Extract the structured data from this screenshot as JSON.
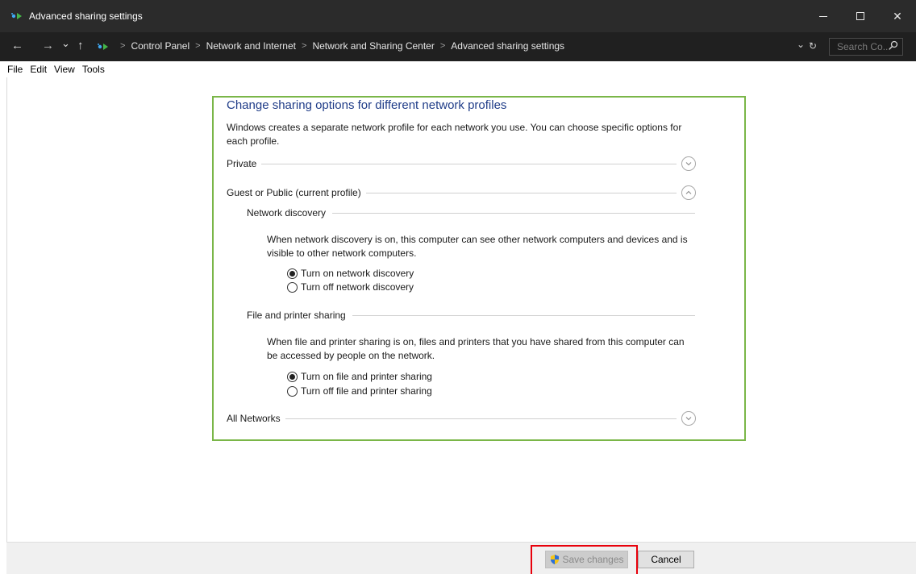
{
  "window": {
    "title": "Advanced sharing settings",
    "controls": {
      "minimize": "—",
      "close": "✕"
    }
  },
  "nav": {
    "back": "←",
    "forward": "→",
    "recent": "⌄",
    "up": "↑"
  },
  "breadcrumbs": [
    "Control Panel",
    "Network and Internet",
    "Network and Sharing Center",
    "Advanced sharing settings"
  ],
  "breadcrumb_separator": ">",
  "address": {
    "dropdown": "⌄",
    "refresh": "↻"
  },
  "search": {
    "placeholder": "Search Co...",
    "icon": "search-icon"
  },
  "menu": [
    "File",
    "Edit",
    "View",
    "Tools"
  ],
  "main": {
    "heading": "Change sharing options for different network profiles",
    "description": "Windows creates a separate network profile for each network you use. You can choose specific options for each profile.",
    "profiles": {
      "private": {
        "label": "Private",
        "expanded": false
      },
      "guest": {
        "label": "Guest or Public (current profile)",
        "expanded": true
      },
      "all": {
        "label": "All Networks",
        "expanded": false
      }
    },
    "network_discovery": {
      "label": "Network discovery",
      "description": "When network discovery is on, this computer can see other network computers and devices and is visible to other network computers.",
      "options": [
        {
          "label": "Turn on network discovery",
          "selected": true
        },
        {
          "label": "Turn off network discovery",
          "selected": false
        }
      ]
    },
    "file_printer_sharing": {
      "label": "File and printer sharing",
      "description": "When file and printer sharing is on, files and printers that you have shared from this computer can be accessed by people on the network.",
      "options": [
        {
          "label": "Turn on file and printer sharing",
          "selected": true
        },
        {
          "label": "Turn off file and printer sharing",
          "selected": false
        }
      ]
    }
  },
  "footer": {
    "save_label": "Save changes",
    "save_enabled": false,
    "cancel_label": "Cancel"
  },
  "colors": {
    "panel_border": "#7ab648",
    "heading": "#1f3c88",
    "highlight": "#e8000b",
    "titlebar": "#2b2b2b"
  }
}
